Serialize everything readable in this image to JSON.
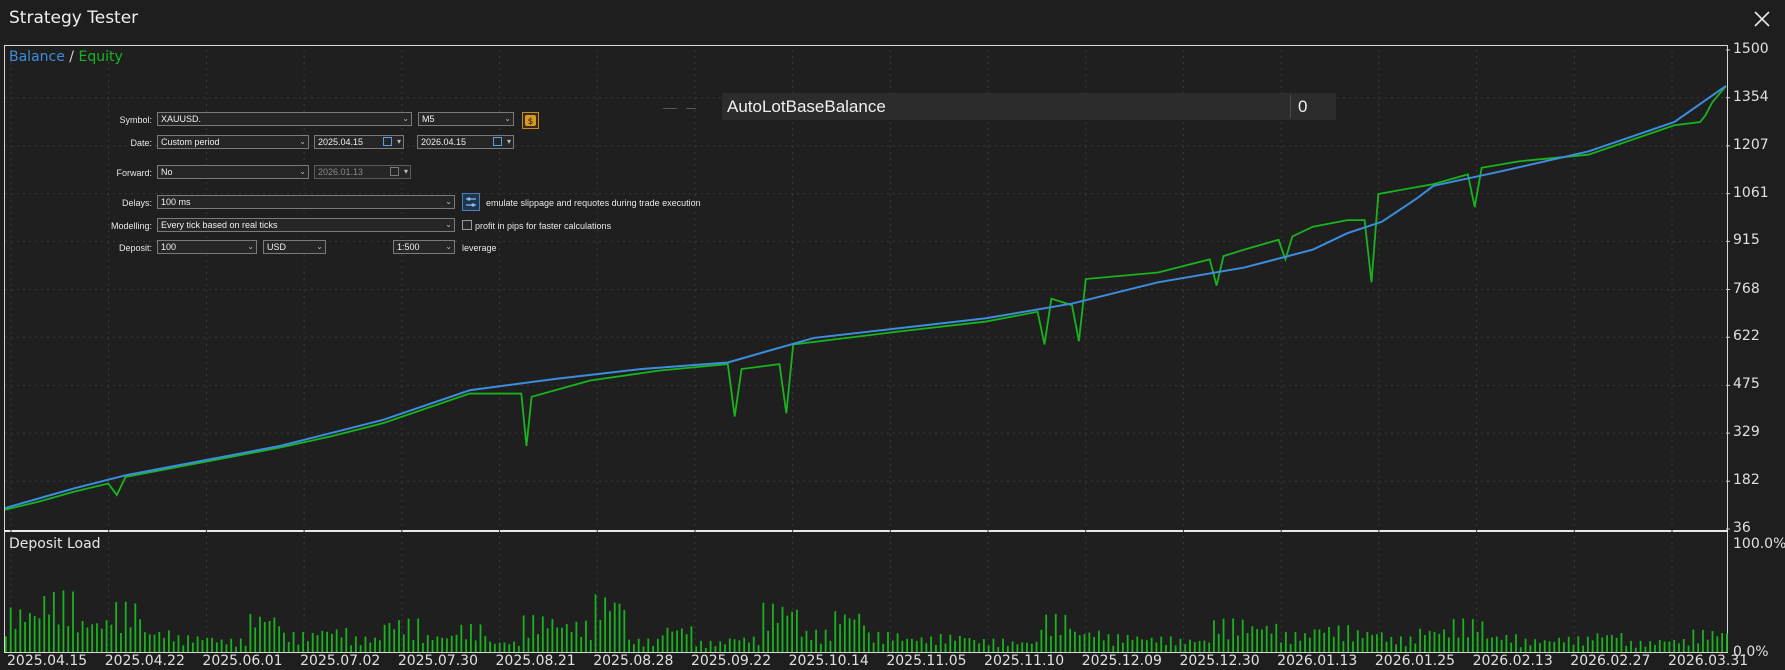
{
  "window": {
    "title": "Strategy Tester"
  },
  "legend": {
    "balance": "Balance",
    "slash": "/",
    "equity": "Equity"
  },
  "colors": {
    "balance": "#3c8dde",
    "equity": "#18b41d",
    "background": "#1f1f1f",
    "grid": "#3a3a3a"
  },
  "settings": {
    "symbol_label": "Symbol:",
    "symbol_value": "XAUUSD.",
    "period_value": "M5",
    "date_label": "Date:",
    "date_mode": "Custom period",
    "date_from": "2025.04.15",
    "date_to": "2026.04.15",
    "forward_label": "Forward:",
    "forward_value": "No",
    "forward_date": "2026.01.13",
    "delays_label": "Delays:",
    "delays_value": "100 ms",
    "slippage_note": "emulate slippage and requotes during trade execution",
    "modelling_label": "Modelling:",
    "modelling_value": "Every tick based on real ticks",
    "pips_note": "profit in pips for faster calculations",
    "deposit_label": "Deposit:",
    "deposit_value": "100",
    "currency_value": "USD",
    "leverage_value": "1:500",
    "leverage_note": "leverage"
  },
  "parameter": {
    "name": "AutoLotBaseBalance",
    "value": "0"
  },
  "deposit_load": {
    "label": "Deposit Load",
    "max_label": "100.0%",
    "min_label": "0.0%"
  },
  "chart_data": {
    "type": "line",
    "title": "",
    "ylabel": "",
    "yticks": [
      "1500",
      "1354",
      "1207",
      "1061",
      "915",
      "768",
      "622",
      "475",
      "329",
      "182",
      "36"
    ],
    "ylim": [
      36,
      1500
    ],
    "x_labels": [
      "2025.04.15",
      "2025.04.22",
      "2025.06.01",
      "2025.07.02",
      "2025.07.30",
      "2025.08.21",
      "2025.08.28",
      "2025.09.22",
      "2025.10.14",
      "2025.11.05",
      "2025.11.10",
      "2025.12.09",
      "2025.12.30",
      "2026.01.13",
      "2026.01.25",
      "2026.02.13",
      "2026.02.27",
      "2026.03.31"
    ],
    "grid": true,
    "legend_position": "top-left",
    "series": [
      {
        "name": "Balance",
        "x": [
          0,
          2,
          4,
          7,
          10,
          13,
          16,
          19,
          22,
          27,
          32,
          37,
          42,
          47,
          52,
          57,
          62,
          67,
          72,
          76,
          78,
          80,
          82,
          83,
          87,
          92,
          97,
          100
        ],
        "values": [
          100,
          130,
          160,
          200,
          230,
          260,
          290,
          330,
          370,
          460,
          495,
          525,
          545,
          620,
          650,
          680,
          725,
          790,
          835,
          890,
          940,
          975,
          1045,
          1085,
          1130,
          1190,
          1280,
          1390
        ]
      },
      {
        "name": "Equity",
        "x": [
          0,
          2,
          4,
          6,
          6.5,
          7,
          10,
          13,
          16,
          19,
          22,
          27,
          30,
          30.3,
          30.6,
          34,
          38,
          42,
          42.4,
          42.8,
          45,
          45.4,
          45.8,
          52,
          57,
          60,
          60.4,
          60.8,
          62,
          62.4,
          62.8,
          67,
          70,
          70.4,
          70.8,
          72,
          74,
          74.4,
          74.8,
          76,
          78,
          79,
          79.4,
          79.8,
          83,
          85,
          85.4,
          85.8,
          88,
          92,
          97,
          98.5,
          98.8,
          99.2,
          100
        ],
        "values": [
          95,
          120,
          150,
          175,
          140,
          195,
          225,
          255,
          285,
          320,
          360,
          450,
          450,
          290,
          440,
          490,
          520,
          540,
          380,
          525,
          540,
          390,
          600,
          640,
          670,
          700,
          600,
          740,
          720,
          610,
          800,
          820,
          860,
          780,
          870,
          890,
          920,
          860,
          930,
          960,
          980,
          980,
          790,
          1060,
          1090,
          1120,
          1020,
          1140,
          1160,
          1180,
          1270,
          1280,
          1300,
          1340,
          1390
        ]
      },
      {
        "name": "Deposit Load",
        "x": [
          0,
          2,
          4,
          6,
          8,
          10,
          12,
          14,
          16,
          18,
          20,
          22,
          24,
          26,
          28,
          30,
          32,
          34,
          36,
          38,
          40,
          42,
          44,
          46,
          48,
          50,
          52,
          54,
          56,
          58,
          60,
          62,
          64,
          66,
          68,
          70,
          72,
          74,
          76,
          78,
          80,
          82,
          84,
          86,
          88,
          90,
          92,
          94,
          96,
          98,
          100
        ],
        "values": [
          40,
          55,
          30,
          45,
          20,
          15,
          12,
          35,
          18,
          22,
          14,
          30,
          16,
          25,
          10,
          33,
          28,
          52,
          12,
          24,
          10,
          14,
          44,
          20,
          38,
          18,
          14,
          16,
          12,
          10,
          34,
          20,
          16,
          14,
          12,
          30,
          26,
          18,
          24,
          20,
          14,
          22,
          30,
          16,
          12,
          14,
          18,
          10,
          12,
          20,
          8
        ]
      }
    ]
  }
}
